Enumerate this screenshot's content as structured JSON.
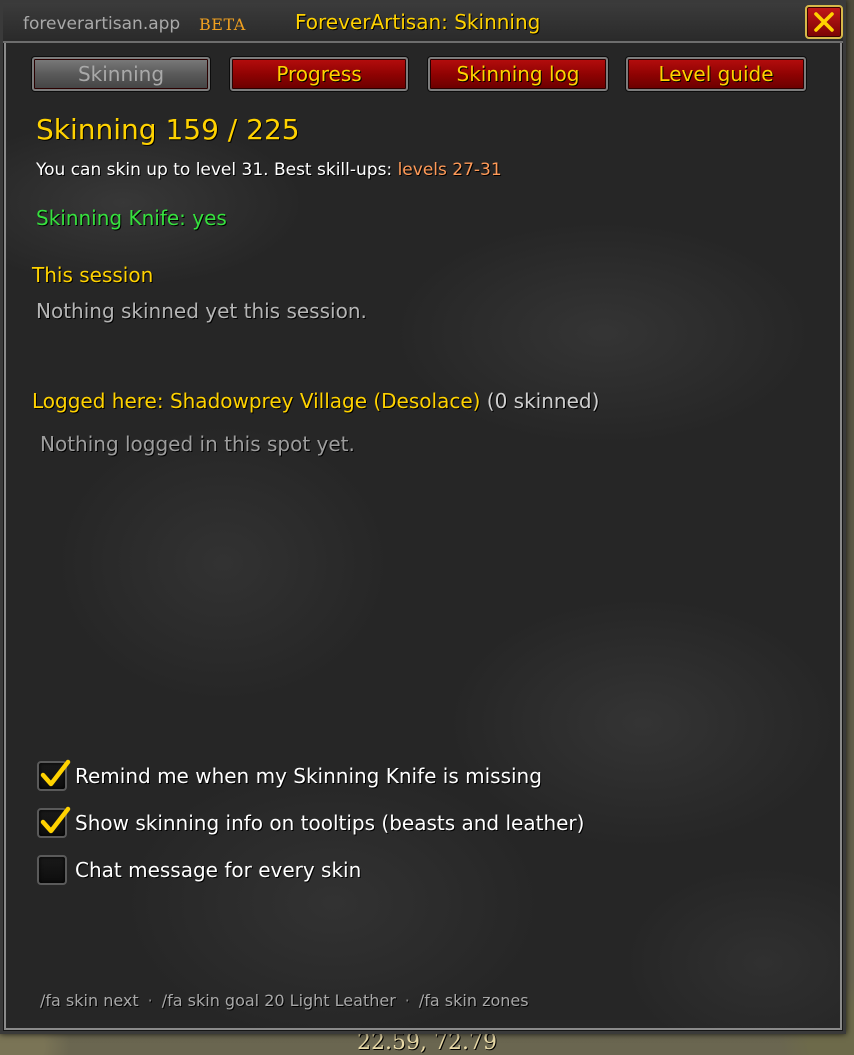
{
  "window": {
    "brand_url": "foreverartisan.app",
    "brand_badge": "BETA",
    "title": "ForeverArtisan: Skinning",
    "close_icon": "close-x-icon"
  },
  "tabs": [
    {
      "label": "Skinning",
      "active": true
    },
    {
      "label": "Progress",
      "active": false
    },
    {
      "label": "Skinning log",
      "active": false
    },
    {
      "label": "Level guide",
      "active": false
    }
  ],
  "skill": {
    "heading": "Skinning 159 / 225",
    "info_prefix": "You can skin up to level 31.  Best skill-ups: ",
    "info_levels": "levels 27-31",
    "knife_status": "Skinning Knife: yes"
  },
  "session": {
    "title": "This session",
    "empty_text": "Nothing skinned yet this session."
  },
  "logged": {
    "title": "Logged here: Shadowprey Village (Desolace)",
    "count": "(0 skinned)",
    "empty_text": "Nothing logged in this spot yet."
  },
  "options": [
    {
      "label": "Remind me when my Skinning Knife is missing",
      "checked": true
    },
    {
      "label": "Show skinning info on tooltips (beasts and leather)",
      "checked": true
    },
    {
      "label": "Chat message for every skin",
      "checked": false
    }
  ],
  "footer": {
    "commands": [
      "/fa skin next",
      "/fa skin goal 20 Light Leather",
      "/fa skin zones"
    ],
    "separator": "·"
  },
  "background_readout": "22.59, 72.79",
  "colors": {
    "gold": "#ffd200",
    "green": "#36e03e",
    "orange": "#ff9a58",
    "tab_red": "#8c0202",
    "beta_orange": "#f0a020"
  }
}
